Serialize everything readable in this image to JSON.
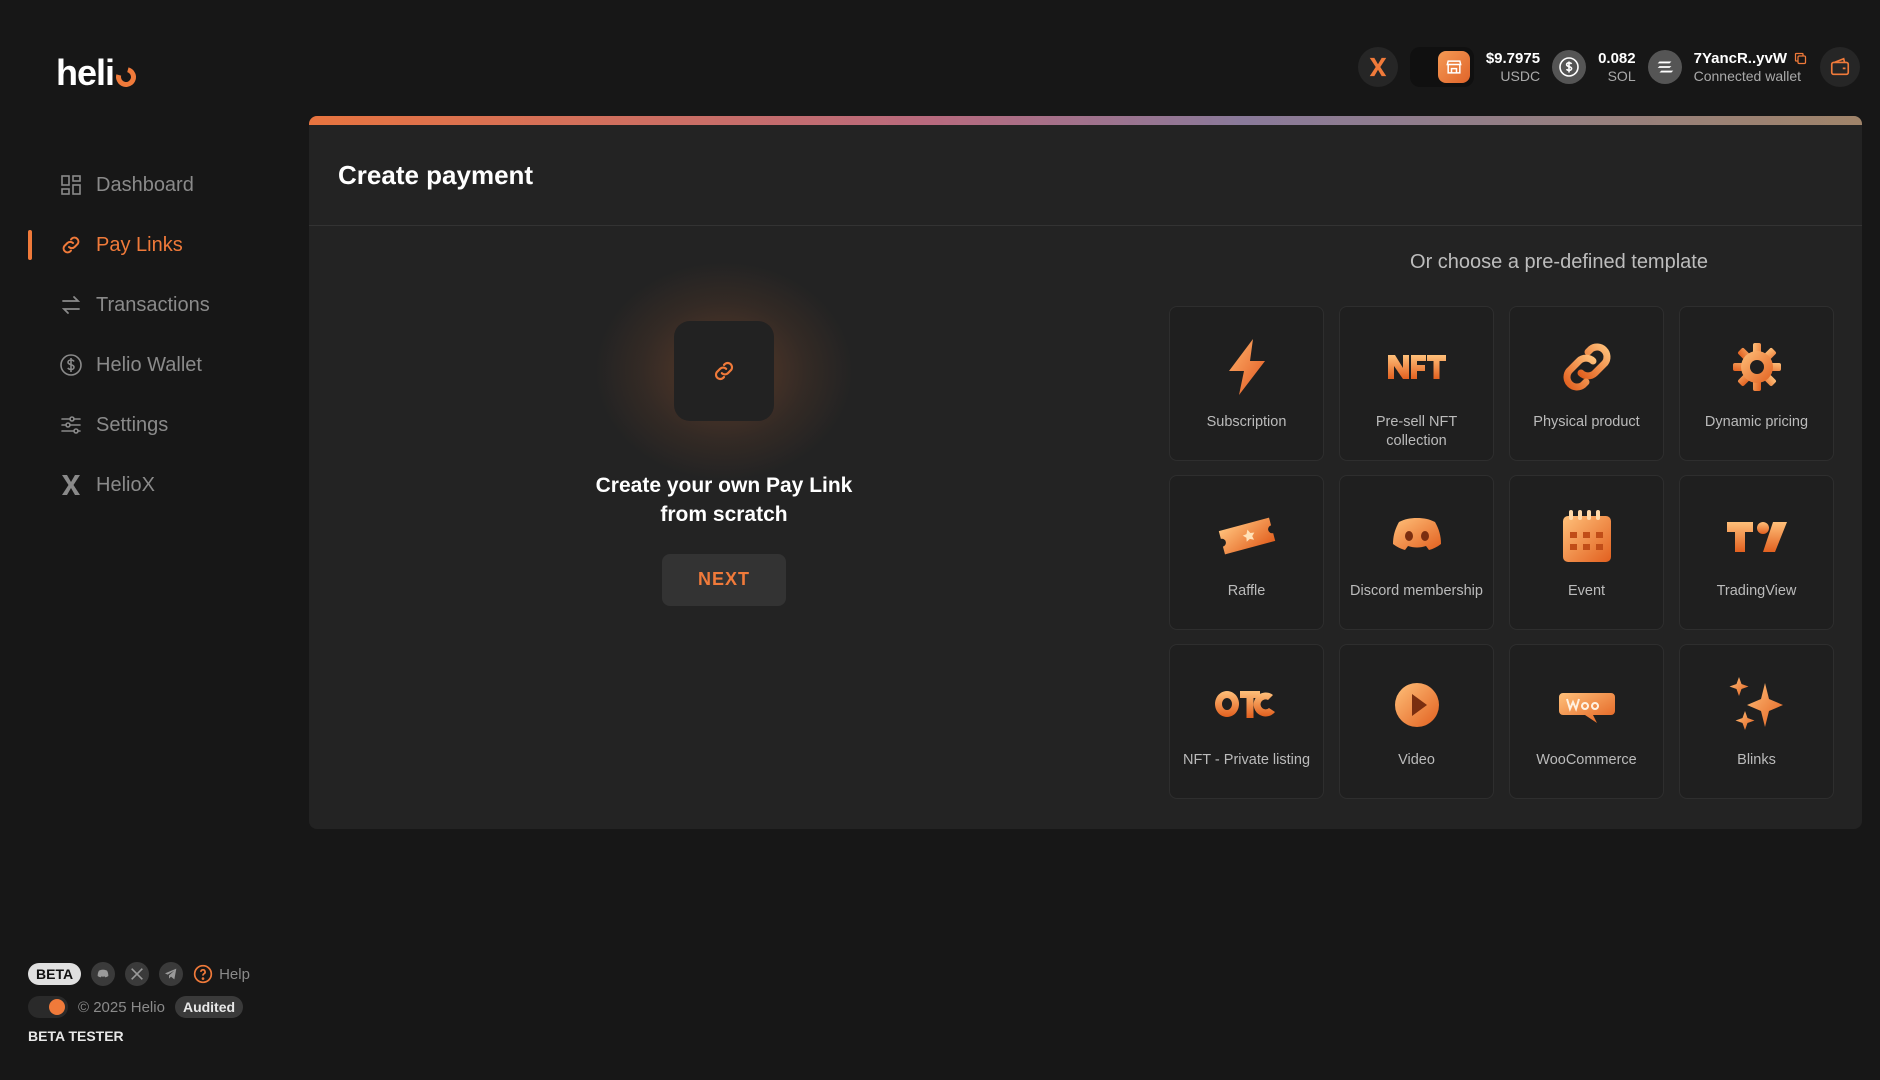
{
  "app": {
    "logo_text": "heli"
  },
  "sidebar": {
    "items": [
      {
        "label": "Dashboard",
        "icon": "dashboard-icon",
        "active": false
      },
      {
        "label": "Pay Links",
        "icon": "link-icon",
        "active": true
      },
      {
        "label": "Transactions",
        "icon": "transfer-icon",
        "active": false
      },
      {
        "label": "Helio Wallet",
        "icon": "dollar-circle-icon",
        "active": false
      },
      {
        "label": "Settings",
        "icon": "sliders-icon",
        "active": false
      },
      {
        "label": "HelioX",
        "icon": "x-logo-icon",
        "active": false
      }
    ],
    "footer": {
      "beta_badge": "BETA",
      "help_label": "Help",
      "copyright": "© 2025 Helio",
      "audited_badge": "Audited",
      "beta_tester": "BETA TESTER"
    }
  },
  "topbar": {
    "usdc": {
      "value": "$9.7975",
      "unit": "USDC"
    },
    "sol": {
      "value": "0.082",
      "unit": "SOL"
    },
    "wallet": {
      "address": "7YancR..yvW",
      "status": "Connected wallet"
    }
  },
  "main": {
    "title": "Create payment",
    "scratch": {
      "title_line1": "Create your own Pay Link",
      "title_line2": "from scratch",
      "next_label": "NEXT"
    },
    "templates_heading": "Or choose a pre-defined template",
    "templates": [
      {
        "label": "Subscription",
        "icon": "lightning-icon"
      },
      {
        "label": "Pre-sell NFT collection",
        "icon": "nft-icon"
      },
      {
        "label": "Physical product",
        "icon": "chain-link-icon"
      },
      {
        "label": "Dynamic pricing",
        "icon": "gear-icon"
      },
      {
        "label": "Raffle",
        "icon": "ticket-icon"
      },
      {
        "label": "Discord membership",
        "icon": "discord-icon"
      },
      {
        "label": "Event",
        "icon": "calendar-icon"
      },
      {
        "label": "TradingView",
        "icon": "tradingview-icon"
      },
      {
        "label": "NFT - Private listing",
        "icon": "otc-icon"
      },
      {
        "label": "Video",
        "icon": "play-icon"
      },
      {
        "label": "WooCommerce",
        "icon": "woocommerce-icon"
      },
      {
        "label": "Blinks",
        "icon": "sparkle-icon"
      }
    ]
  },
  "colors": {
    "accent": "#f07a3a",
    "background": "#171717",
    "panel": "#232323"
  }
}
